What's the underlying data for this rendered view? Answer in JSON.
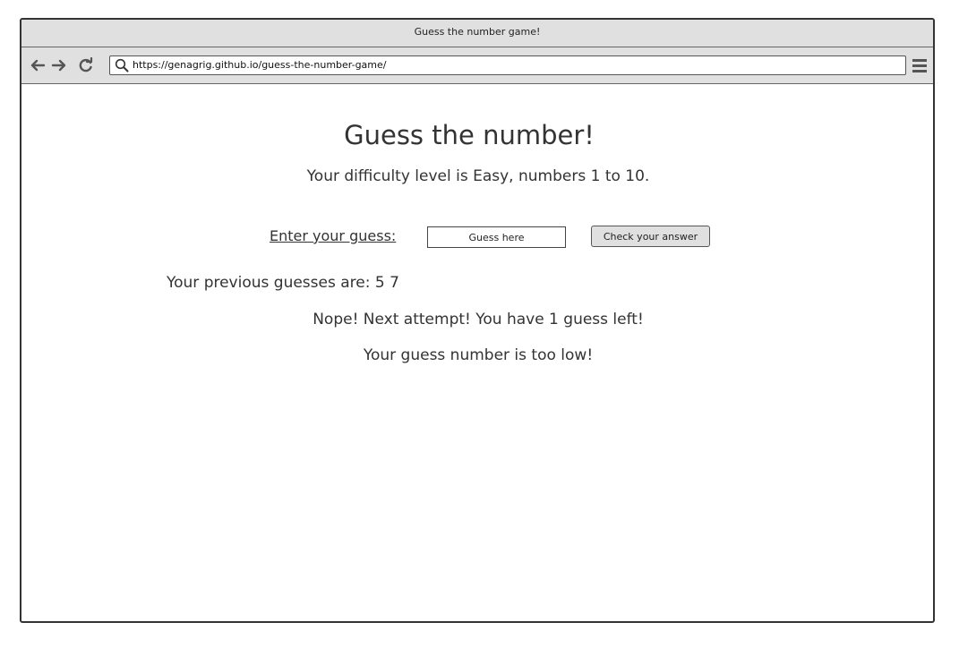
{
  "window": {
    "title": "Guess the number game!"
  },
  "browser": {
    "url": "https://genagrig.github.io/guess-the-number-game/",
    "icons": [
      "back-arrow-icon",
      "forward-arrow-icon",
      "reload-icon",
      "search-icon",
      "hamburger-menu-icon"
    ]
  },
  "page": {
    "heading": "Guess the number!",
    "difficulty_text": "Your difficulty level is Easy, numbers 1 to 10.",
    "guess_label": "Enter your guess:",
    "guess_input": {
      "value": "",
      "placeholder": "Guess here"
    },
    "check_button_label": "Check your answer",
    "previous_guesses_text": "Your previous guesses are: 5 7",
    "attempt_message": "Nope! Next attempt! You have 1 guess left!",
    "hint_message": "Your guess number is too low!"
  },
  "colors": {
    "chrome_background": "#e0e0e0",
    "border": "#333333",
    "text": "#333333"
  }
}
